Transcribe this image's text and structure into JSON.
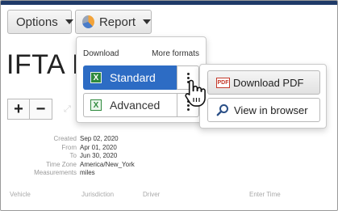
{
  "toolbar": {
    "options_label": "Options",
    "report_label": "Report"
  },
  "page": {
    "title": "IFTA R"
  },
  "dropdown": {
    "header_left": "Download",
    "header_right": "More formats",
    "items": [
      {
        "label": "Standard",
        "icon": "X"
      },
      {
        "label": "Advanced",
        "icon": "X"
      }
    ]
  },
  "flyout": {
    "pdf_label": "Download PDF",
    "pdf_icon_text": "PDF",
    "browser_label": "View in browser"
  },
  "meta": [
    {
      "label": "Created",
      "value": "Sep 02, 2020"
    },
    {
      "label": "From",
      "value": "Apr 01, 2020"
    },
    {
      "label": "To",
      "value": "Jun 30, 2020"
    },
    {
      "label": "Time Zone",
      "value": "America/New_York"
    },
    {
      "label": "Measurements",
      "value": "miles"
    }
  ],
  "columns": [
    "Vehicle",
    "Jurisdiction",
    "Driver",
    "Enter Time"
  ],
  "colors": {
    "accent": "#2d6cc4",
    "excel_green": "#2f8a3e",
    "pdf_red": "#c53a2b"
  },
  "icons": {
    "options_caret": "chevron-down-icon",
    "report_icon": "pie-chart-icon",
    "excel": "excel-icon",
    "pdf": "pdf-icon",
    "browser": "search-icon",
    "more": "vertical-dots-icon",
    "cursor": "hand-pointer-icon"
  }
}
